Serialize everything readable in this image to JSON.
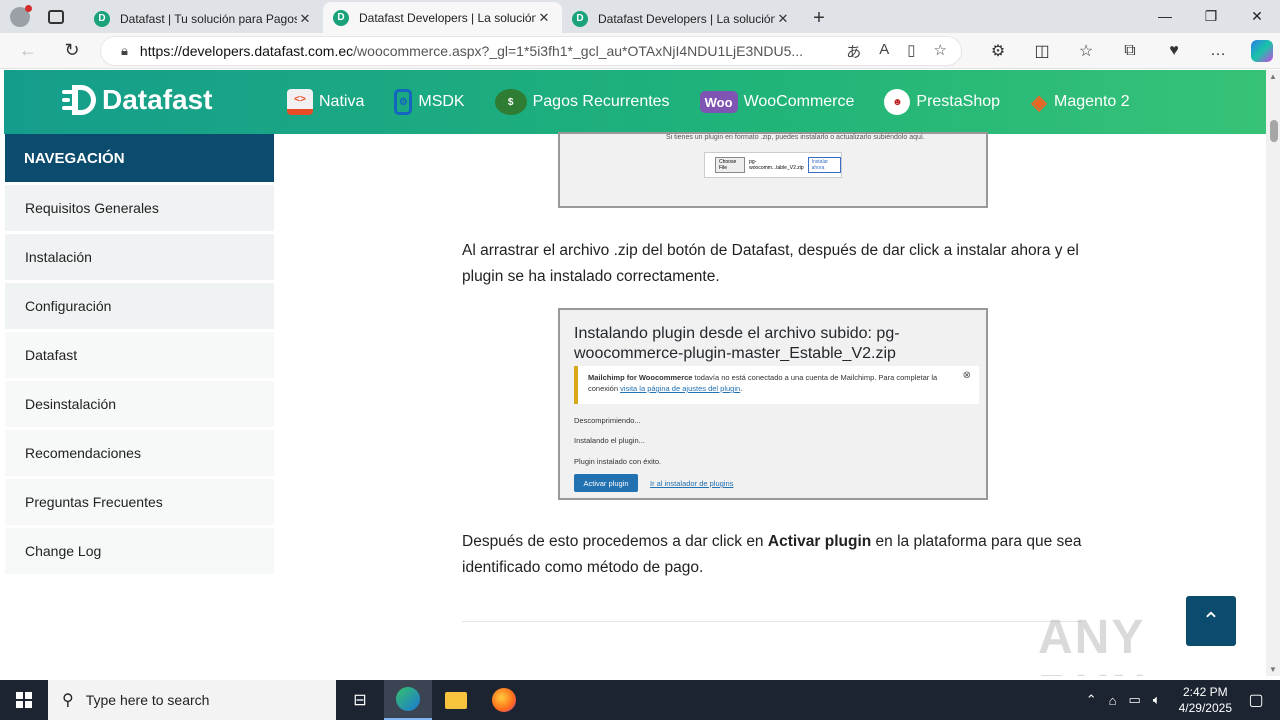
{
  "browser": {
    "tabs": [
      {
        "title": "Datafast | Tu solución para Pagos"
      },
      {
        "title": "Datafast Developers | La solución"
      },
      {
        "title": "Datafast Developers | La solución"
      }
    ],
    "url_host": "https://developers.datafast.com.ec",
    "url_path": "/woocommerce.aspx?_gl=1*5i3fh1*_gcl_au*OTAxNjI4NDU1LjE3NDU5..."
  },
  "site": {
    "logo_text": "Datafast",
    "menu": [
      {
        "label": "Nativa",
        "icon": "html-icon"
      },
      {
        "label": "MSDK",
        "icon": "mobile-sdk-icon"
      },
      {
        "label": "Pagos Recurrentes",
        "icon": "recurring-payments-icon"
      },
      {
        "label": "WooCommerce",
        "icon": "woocommerce-icon"
      },
      {
        "label": "PrestaShop",
        "icon": "prestashop-icon"
      },
      {
        "label": "Magento 2",
        "icon": "magento-icon"
      }
    ]
  },
  "sidebar": {
    "heading": "NAVEGACIÓN",
    "items": [
      {
        "label": "Requisitos Generales"
      },
      {
        "label": "Instalación"
      },
      {
        "label": "Configuración"
      },
      {
        "label": "Datafast"
      },
      {
        "label": "Desinstalación"
      },
      {
        "label": "Recomendaciones"
      },
      {
        "label": "Preguntas Frecuentes"
      },
      {
        "label": "Change Log"
      }
    ]
  },
  "content": {
    "shot1_text": "Si tienes un plugin en formato .zip, puedes instalarlo o actualizarlo subiéndolo aquí.",
    "shot1_choose": "Choose File",
    "shot1_file": "pg-woocomm...table_V2.zip",
    "shot1_install": "Instalar ahora",
    "para1": "Al arrastrar el archivo .zip del botón de Datafast, después de dar click a instalar ahora y el plugin se ha instalado correctamente.",
    "shot2": {
      "title": "Instalando plugin desde el archivo subido: pg-woocommerce-plugin-master_Estable_V2.zip",
      "notice_bold": "Mailchimp for Woocommerce",
      "notice_text": " todavía no está conectado a una cuenta de Mailchimp. Para completar la conexión ",
      "notice_link": "visita la página de ajustes del plugin",
      "line1": "Descomprimiendo...",
      "line2": "Instalando el plugin...",
      "line3": "Plugin instalado con éxito.",
      "button": "Activar plugin",
      "link": "Ir al instalador de plugins"
    },
    "para2_a": "Después de esto procedemos a dar click en ",
    "para2_b": "Activar plugin",
    "para2_c": " en la plataforma para que sea identificado como método de pago."
  },
  "watermark": "ANY RUN",
  "taskbar": {
    "search_placeholder": "Type here to search",
    "time": "2:42 PM",
    "date": "4/29/2025"
  }
}
